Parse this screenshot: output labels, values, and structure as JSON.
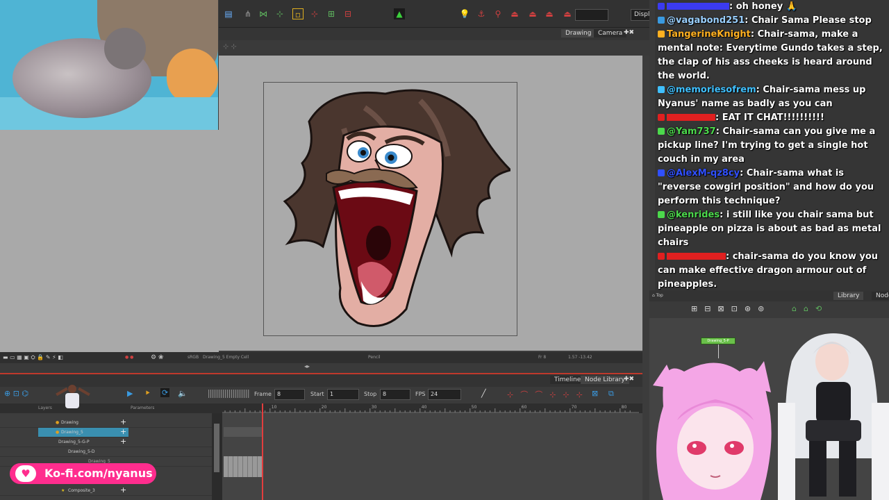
{
  "toolbar": {
    "display_select": "Display"
  },
  "view_tabs": {
    "drawing": "Drawing",
    "camera": "Camera"
  },
  "status_bar": {
    "color_space": "sRGB",
    "cell": "Drawing_5 Empty Cell",
    "tool": "Pencil",
    "frame": "Fr 8",
    "coords": "1.57 -13.42"
  },
  "timeline": {
    "tabs": [
      "Timeline",
      "Node Library"
    ],
    "frame_label": "Frame",
    "frame_value": "8",
    "start_label": "Start",
    "start_value": "1",
    "stop_label": "Stop",
    "stop_value": "8",
    "fps_label": "FPS",
    "fps_value": "24",
    "header_layers": "Layers",
    "header_params": "Parameters",
    "ruler_ticks": [
      "10",
      "20",
      "30",
      "40",
      "50",
      "60",
      "70",
      "80"
    ],
    "layers": [
      "Drawing",
      "Drawing_5",
      "Drawing_5-G-P",
      "Drawing_5-D",
      "Drawing_5",
      "Composite_3"
    ]
  },
  "kofi": {
    "label": "Ko-fi.com/nyanus"
  },
  "chat": [
    {
      "user": "",
      "text": ": oh honey 🙏",
      "color": "#3b3bf0"
    },
    {
      "user": "@vagabond251",
      "text": ": Chair Sama Please stop",
      "color": "#6ecbff"
    },
    {
      "user": "TangerineKnight",
      "text": ": Chair-sama, make a mental note: Everytime Gundo takes a step, the clap of his ass cheeks is heard around the world.",
      "color": "#ffb020"
    },
    {
      "user": "@memoriesofrem",
      "text": ": Chair-sama mess up Nyanus' name as badly as you can",
      "color": "#40c0ff"
    },
    {
      "user": "",
      "text": ": EAT IT CHAT!!!!!!!!!!",
      "color": "#e02020"
    },
    {
      "user": "@Yam737",
      "text": ": Chair-sama can you give me a pickup line? I'm trying to get a single hot couch in my area",
      "color": "#4cd94c"
    },
    {
      "user": "@AlexM-qz8cy",
      "text": ": Chair-sama what is \"reverse cowgirl position\" and how do you perform this technique?",
      "color": "#3050ff"
    },
    {
      "user": "@kenrides",
      "text": ": i still like you chair sama but pineapple on pizza is about as bad as metal chairs",
      "color": "#4cd94c"
    },
    {
      "user": "",
      "text": ": chair-sama do you know you can make effective dragon armour out of pineapples.",
      "color": "#e02020"
    }
  ],
  "node_panel": {
    "tabs": [
      "Library",
      "Node"
    ],
    "top_label": "Top",
    "node_name": "Drawing_5-P"
  }
}
